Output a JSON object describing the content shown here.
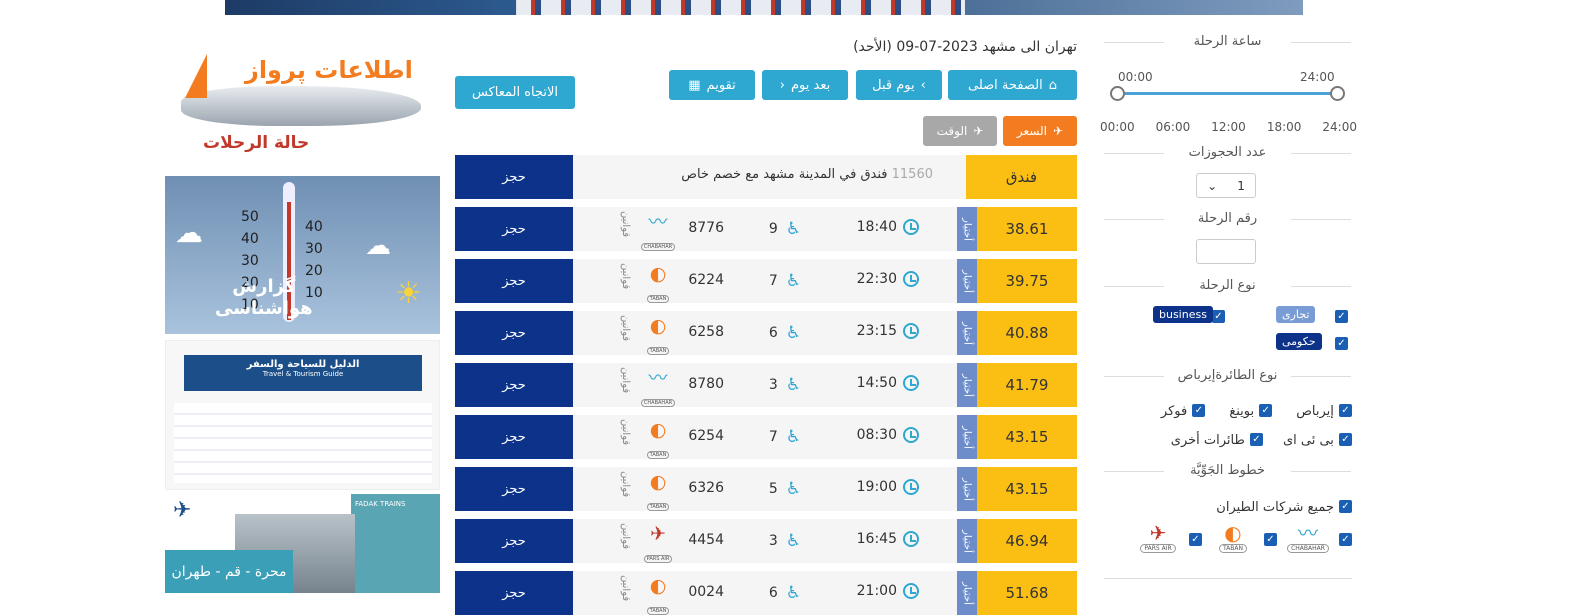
{
  "filters": {
    "time_title": "ساعة الرحلة",
    "range_min": "00:00",
    "range_max": "24:00",
    "ticks": [
      "24:00",
      "18:00",
      "12:00",
      "06:00",
      "00:00"
    ],
    "bookings_title": "عدد الحجوزات",
    "bookings_value": "1",
    "flight_no_title": "رقم الرحلة",
    "flight_no_placeholder": "",
    "flight_type_title": "نوع الرحلة",
    "flight_types": [
      "تجاری",
      "business",
      "حكومی"
    ],
    "aircraft_title": "نوع الطائرةإيرباص",
    "aircraft": [
      "إيرباص",
      "بوينغ",
      "فوكر",
      "بی ئی ای",
      "طائرات أخرى"
    ],
    "airlines_title": "خطوط الجَوِّيَّة",
    "all_airlines": "جميع شركات الطيران",
    "airline_logos": [
      "CHABAHAR",
      "TABAN",
      "PARS AIR"
    ]
  },
  "header": {
    "route": "تهران الى مشهد 2023-07-09 (الأحد)",
    "home": "الصفحة اصلى",
    "prev_day": "يوم قبل",
    "next_day": "بعد يوم",
    "calendar": "تقويم",
    "reverse": "الاتجاه المعاكس",
    "sort_price": "السعر",
    "sort_time": "الوقت"
  },
  "hotel": {
    "label": "فندق",
    "count": "11560",
    "text": "فندق في المدينة مشهد مع خصم خاص",
    "book": "حجز"
  },
  "flights": [
    {
      "price": "38.61",
      "time": "18:40",
      "seats": "9",
      "fno": "8776",
      "airline": "CHABAHAR",
      "book": "حجز",
      "badge": "أختيار",
      "rules": "قوانين"
    },
    {
      "price": "39.75",
      "time": "22:30",
      "seats": "7",
      "fno": "6224",
      "airline": "TABAN",
      "book": "حجز",
      "badge": "أختيار",
      "rules": "قوانين"
    },
    {
      "price": "40.88",
      "time": "23:15",
      "seats": "6",
      "fno": "6258",
      "airline": "TABAN",
      "book": "حجز",
      "badge": "أختيار",
      "rules": "قوانين"
    },
    {
      "price": "41.79",
      "time": "14:50",
      "seats": "3",
      "fno": "8780",
      "airline": "CHABAHAR",
      "book": "حجز",
      "badge": "أختيار",
      "rules": "قوانين"
    },
    {
      "price": "43.15",
      "time": "08:30",
      "seats": "7",
      "fno": "6254",
      "airline": "TABAN",
      "book": "حجز",
      "badge": "أختيار",
      "rules": "قوانين"
    },
    {
      "price": "43.15",
      "time": "19:00",
      "seats": "5",
      "fno": "6326",
      "airline": "TABAN",
      "book": "حجز",
      "badge": "أختيار",
      "rules": "قوانين"
    },
    {
      "price": "46.94",
      "time": "16:45",
      "seats": "3",
      "fno": "4454",
      "airline": "PARS AIR",
      "book": "حجز",
      "badge": "أختيار",
      "rules": "قوانين"
    },
    {
      "price": "51.68",
      "time": "21:00",
      "seats": "6",
      "fno": "0024",
      "airline": "TABAN",
      "book": "حجز",
      "badge": "أختيار",
      "rules": "قوانين"
    }
  ],
  "ads": {
    "ad1_title": "اطلاعات پرواز",
    "ad1_sub": "حالة الرحلات",
    "ad2_title": "گزارش",
    "ad2_sub": "هواشناسی",
    "ad2_scale": [
      "50",
      "40",
      "30",
      "20",
      "10"
    ],
    "ad3_title": "الدليل للسياحة والسفر",
    "ad3_sub": "Travel & Tourism Guide",
    "ad4_title": "محرة - قم - طهران",
    "ad4_brand": "FADAK TRAINS"
  },
  "colors": {
    "accent": "#2ea7d1",
    "price": "#fbbf14",
    "book": "#0d3289",
    "sort_active": "#f47c20",
    "sort_inactive": "#a8a8a8"
  }
}
